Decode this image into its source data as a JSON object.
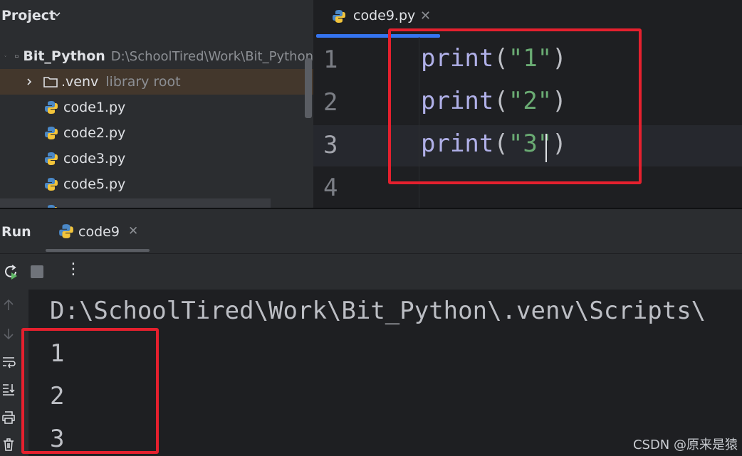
{
  "project": {
    "title": "Project",
    "root": {
      "name": "Bit_Python",
      "path": "D:\\SchoolTired\\Work\\Bit_Python"
    },
    "items": [
      {
        "name": ".venv",
        "note": "library root"
      },
      {
        "name": "code1.py"
      },
      {
        "name": "code2.py"
      },
      {
        "name": "code3.py"
      },
      {
        "name": "code5.py"
      }
    ]
  },
  "editor": {
    "tab": {
      "label": "code9.py"
    },
    "line_numbers": [
      "1",
      "2",
      "3",
      "4"
    ],
    "lines": [
      {
        "fn": "print",
        "open": "(",
        "str": "\"1\"",
        "close": ")"
      },
      {
        "fn": "print",
        "open": "(",
        "str": "\"2\"",
        "close": ")"
      },
      {
        "fn": "print",
        "open": "(",
        "str": "\"3\"",
        "close": ")"
      }
    ]
  },
  "run": {
    "title": "Run",
    "tab": {
      "label": "code9"
    },
    "console": {
      "command": "D:\\SchoolTired\\Work\\Bit_Python\\.venv\\Scripts\\",
      "output": [
        "1",
        "2",
        "3"
      ]
    }
  },
  "watermark": "CSDN @原来是猿",
  "colors": {
    "highlight_box": "#e5202e",
    "accent": "#3574f0",
    "string": "#6aab73",
    "keyword": "#b0b0e8"
  }
}
